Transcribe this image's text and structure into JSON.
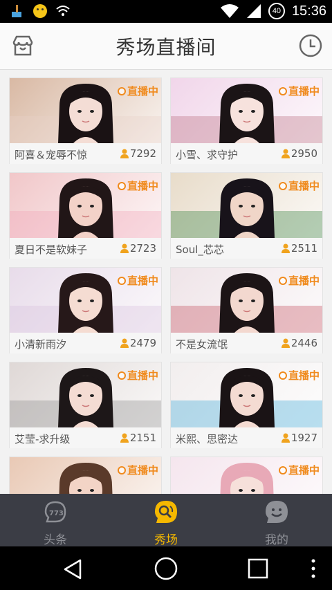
{
  "status_bar": {
    "time": "15:36",
    "battery": "40"
  },
  "header": {
    "title": "秀场直播间",
    "left_icon": "store-icon",
    "right_icon": "clock-icon"
  },
  "live_label": "直播中",
  "cards": [
    {
      "name": "阿喜＆宠辱不惊",
      "viewers": "7292",
      "bg": "#d9b9a4",
      "hair": "#1a1214",
      "skin": "#f4ddd5",
      "accent": "#e8d0c8"
    },
    {
      "name": "小雪、求守护",
      "viewers": "2950",
      "bg": "#f1d6ea",
      "hair": "#1b1416",
      "skin": "#f7e2dd",
      "accent": "#b86a7c"
    },
    {
      "name": "夏日不是软妹子",
      "viewers": "2723",
      "bg": "#f1c7c9",
      "hair": "#211617",
      "skin": "#f3d2c8",
      "accent": "#f2a2b8"
    },
    {
      "name": "Soul_芯芯",
      "viewers": "2511",
      "bg": "#e8dcca",
      "hair": "#18131a",
      "skin": "#f0d6c8",
      "accent": "#2f7a3a"
    },
    {
      "name": "小清新雨汐",
      "viewers": "2479",
      "bg": "#e8dcea",
      "hair": "#261819",
      "skin": "#f5dcd2",
      "accent": "#d6c0dd"
    },
    {
      "name": "不是女流氓",
      "viewers": "2446",
      "bg": "#efe4e8",
      "hair": "#1c1416",
      "skin": "#f3d8cf",
      "accent": "#c44a5a"
    },
    {
      "name": "艾莹-求升级",
      "viewers": "2151",
      "bg": "#dfd8d6",
      "hair": "#1d1718",
      "skin": "#f4dcd3",
      "accent": "#8a8a8a"
    },
    {
      "name": "米熙、思密达",
      "viewers": "1927",
      "bg": "#f2eeee",
      "hair": "#1a1315",
      "skin": "#f4dbd2",
      "accent": "#36a7d6"
    },
    {
      "name": "",
      "viewers": "",
      "bg": "#e9c9b5",
      "hair": "#5a3a2a",
      "skin": "#f3d4c6",
      "accent": "#333"
    },
    {
      "name": "",
      "viewers": "",
      "bg": "#f5e6ee",
      "hair": "#e8a9b7",
      "skin": "#f6e0da",
      "accent": "#e8a9b7"
    }
  ],
  "bottom_nav": {
    "items": [
      {
        "label": "头条",
        "icon": "headline-icon",
        "active": false
      },
      {
        "label": "秀场",
        "icon": "show-icon",
        "active": true
      },
      {
        "label": "我的",
        "icon": "profile-icon",
        "active": false
      }
    ],
    "active_color": "#f5b800",
    "inactive_color": "#8e9096"
  },
  "system_nav": {
    "back_icon": "back-icon",
    "home_icon": "home-icon",
    "recents_icon": "recents-icon",
    "menu_icon": "more-icon"
  }
}
